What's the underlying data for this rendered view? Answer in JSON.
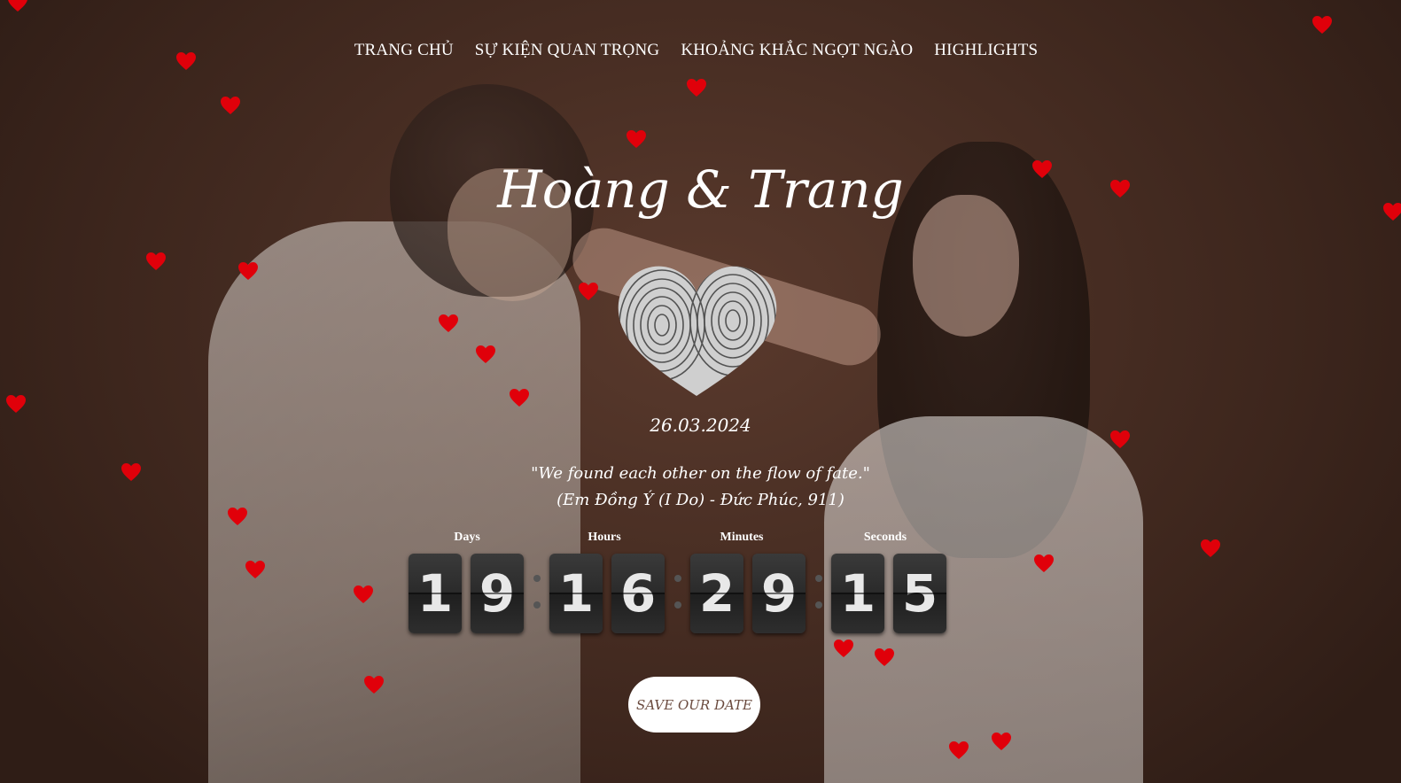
{
  "nav": {
    "items": [
      "TRANG CHỦ",
      "SỰ KIỆN QUAN TRỌNG",
      "KHOẢNG KHẮC NGỌT NGÀO",
      "HIGHLIGHTS"
    ]
  },
  "hero": {
    "title": "Hoàng & Trang",
    "date": "26.03.2024",
    "quote_line1": "\"We found each other on the flow of fate.\"",
    "quote_line2": "(Em Đồng Ý (I Do) - Đức Phúc, 911)"
  },
  "countdown": {
    "labels": {
      "days": "Days",
      "hours": "Hours",
      "minutes": "Minutes",
      "seconds": "Seconds"
    },
    "days": [
      "1",
      "9"
    ],
    "hours": [
      "1",
      "6"
    ],
    "minutes": [
      "2",
      "9"
    ],
    "seconds": [
      "1",
      "5"
    ]
  },
  "cta": {
    "label": "SAVE OUR DATE"
  },
  "colors": {
    "heart": "#e0000a",
    "background": "#4a2e24",
    "button_bg": "#ffffff"
  }
}
